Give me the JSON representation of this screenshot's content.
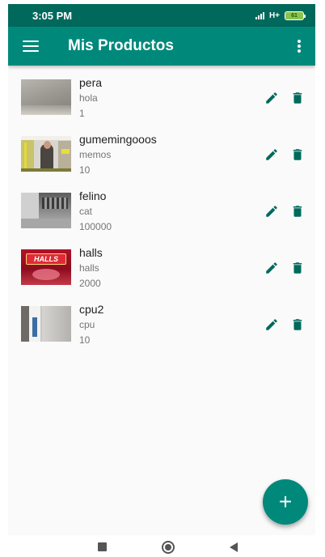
{
  "status_bar": {
    "time": "3:05 PM",
    "network": "H+",
    "battery": "61"
  },
  "app_bar": {
    "title": "Mis Productos",
    "menu_icon": "menu-icon",
    "overflow_icon": "more-vert-icon"
  },
  "products": [
    {
      "name": "pera",
      "description": "hola",
      "quantity": "1"
    },
    {
      "name": "gumemingooos",
      "description": "memos",
      "quantity": "10"
    },
    {
      "name": "felino",
      "description": "cat",
      "quantity": "100000"
    },
    {
      "name": "halls",
      "description": "halls",
      "quantity": "2000",
      "thumb_text": "HALLS"
    },
    {
      "name": "cpu2",
      "description": "cpu",
      "quantity": "10"
    }
  ],
  "row_actions": {
    "edit_icon": "pencil-icon",
    "delete_icon": "trash-icon"
  },
  "fab": {
    "label": "+"
  },
  "colors": {
    "primary": "#00897b",
    "primary_dark": "#00695c",
    "icon_green": "#00695c"
  }
}
